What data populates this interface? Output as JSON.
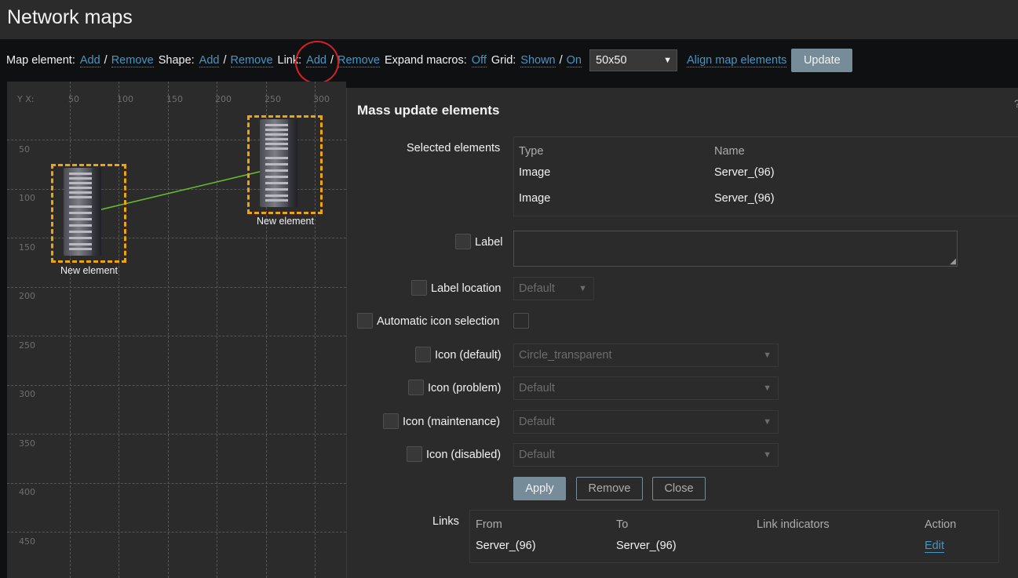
{
  "page": {
    "title": "Network maps"
  },
  "toolbar": {
    "map_element_label": "Map element:",
    "map_element_add": "Add",
    "map_element_remove": "Remove",
    "shape_label": "Shape:",
    "shape_add": "Add",
    "shape_remove": "Remove",
    "link_label": "Link:",
    "link_add": "Add",
    "link_remove": "Remove",
    "expand_macros_label": "Expand macros:",
    "expand_macros_value": "Off",
    "grid_label": "Grid:",
    "grid_shown": "Shown",
    "grid_on": "On",
    "slash": "/",
    "grid_size": "50x50",
    "align_label": "Align map elements",
    "update_label": "Update"
  },
  "map": {
    "axis_corner": "Y X:",
    "x_ticks": [
      "50",
      "100",
      "150",
      "200",
      "250",
      "300"
    ],
    "y_ticks": [
      "50",
      "100",
      "150",
      "200",
      "250",
      "300",
      "350",
      "400",
      "450"
    ],
    "elements": [
      {
        "label": "New element",
        "icon": "server-icon"
      },
      {
        "label": "New element",
        "icon": "server-icon"
      }
    ],
    "link_color": "#6abf2c",
    "selection_color": "#f0a30a"
  },
  "mass_update": {
    "title": "Mass update elements",
    "help": "?",
    "selected_elements_label": "Selected elements",
    "selected_columns": [
      "Type",
      "Name"
    ],
    "selected_rows": [
      [
        "Image",
        "Server_(96)"
      ],
      [
        "Image",
        "Server_(96)"
      ]
    ],
    "label_label": "Label",
    "label_value": "",
    "label_location_label": "Label location",
    "label_location_value": "Default",
    "auto_icon_label": "Automatic icon selection",
    "icon_default_label": "Icon (default)",
    "icon_default_value": "Circle_transparent",
    "icon_problem_label": "Icon (problem)",
    "icon_problem_value": "Default",
    "icon_maintenance_label": "Icon (maintenance)",
    "icon_maintenance_value": "Default",
    "icon_disabled_label": "Icon (disabled)",
    "icon_disabled_value": "Default",
    "apply_label": "Apply",
    "remove_label": "Remove",
    "close_label": "Close",
    "links_label": "Links",
    "links_columns": [
      "From",
      "To",
      "Link indicators",
      "Action"
    ],
    "links_rows": [
      {
        "from": "Server_(96)",
        "to": "Server_(96)",
        "indicators": "",
        "action": "Edit"
      }
    ]
  },
  "colors": {
    "accent_link": "#4796c4",
    "button_primary": "#768d99",
    "annotation_circle": "#d6202a"
  }
}
